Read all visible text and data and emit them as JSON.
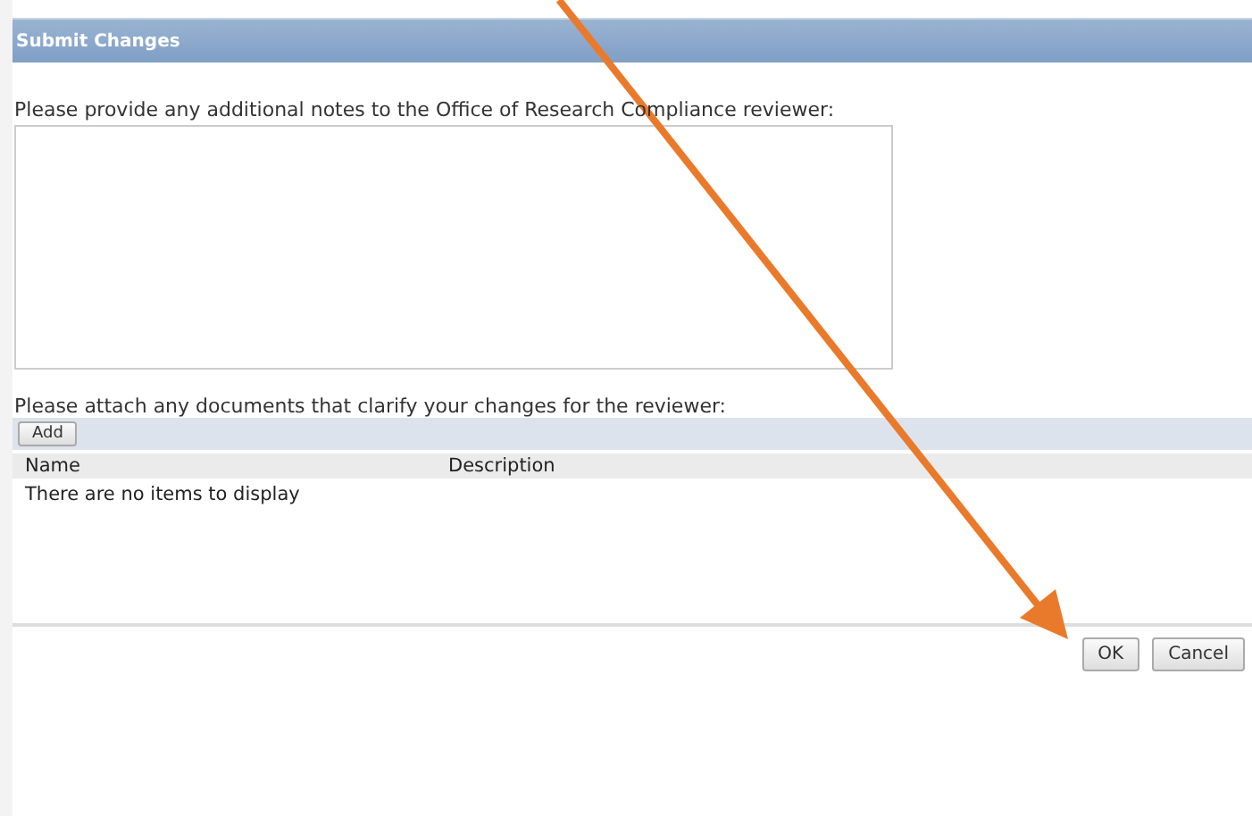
{
  "dialog": {
    "title": "Submit Changes"
  },
  "notes": {
    "label": "Please provide any additional notes to the Office of Research Compliance reviewer:"
  },
  "attachments": {
    "label": "Please attach any documents that clarify your changes for the reviewer:",
    "add_button": "Add",
    "columns": [
      "Name",
      "Description"
    ],
    "empty_message": "There are no items to display"
  },
  "buttons": [
    "OK",
    "Cancel"
  ]
}
